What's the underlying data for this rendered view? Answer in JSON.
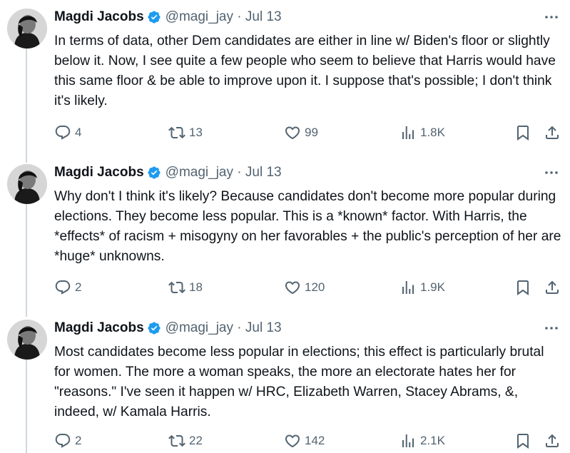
{
  "tweets": [
    {
      "name": "Magdi Jacobs",
      "handle": "@magi_jay",
      "date": "Jul 13",
      "text": "In terms of data, other Dem candidates are either in line w/ Biden's floor or slightly below it. Now, I see quite a few people who seem to believe that Harris would have this same floor & be able to improve upon it. I suppose that's possible; I don't think it's likely.",
      "replies": "4",
      "retweets": "13",
      "likes": "99",
      "views": "1.8K"
    },
    {
      "name": "Magdi Jacobs",
      "handle": "@magi_jay",
      "date": "Jul 13",
      "text": "Why don't I think it's likely? Because candidates don't become more popular during elections. They become less popular. This is a *known* factor. With Harris, the *effects* of racism + misogyny on her favorables + the public's perception of her are *huge* unknowns.",
      "replies": "2",
      "retweets": "18",
      "likes": "120",
      "views": "1.9K"
    },
    {
      "name": "Magdi Jacobs",
      "handle": "@magi_jay",
      "date": "Jul 13",
      "text": "Most candidates become less popular in elections; this effect is particularly brutal for women. The more a woman speaks, the more an electorate hates her for \"reasons.\" I've seen it happen w/ HRC, Elizabeth Warren, Stacey Abrams, &, indeed, w/ Kamala Harris.",
      "replies": "2",
      "retweets": "22",
      "likes": "142",
      "views": "2.1K"
    }
  ],
  "colors": {
    "verified": "#1d9bf0",
    "muted": "#536471",
    "text": "#0f1419",
    "thread_line": "#cfd9de"
  },
  "icons": [
    "verified-badge-icon",
    "more-icon",
    "reply-icon",
    "retweet-icon",
    "like-icon",
    "views-icon",
    "bookmark-icon",
    "share-icon"
  ]
}
